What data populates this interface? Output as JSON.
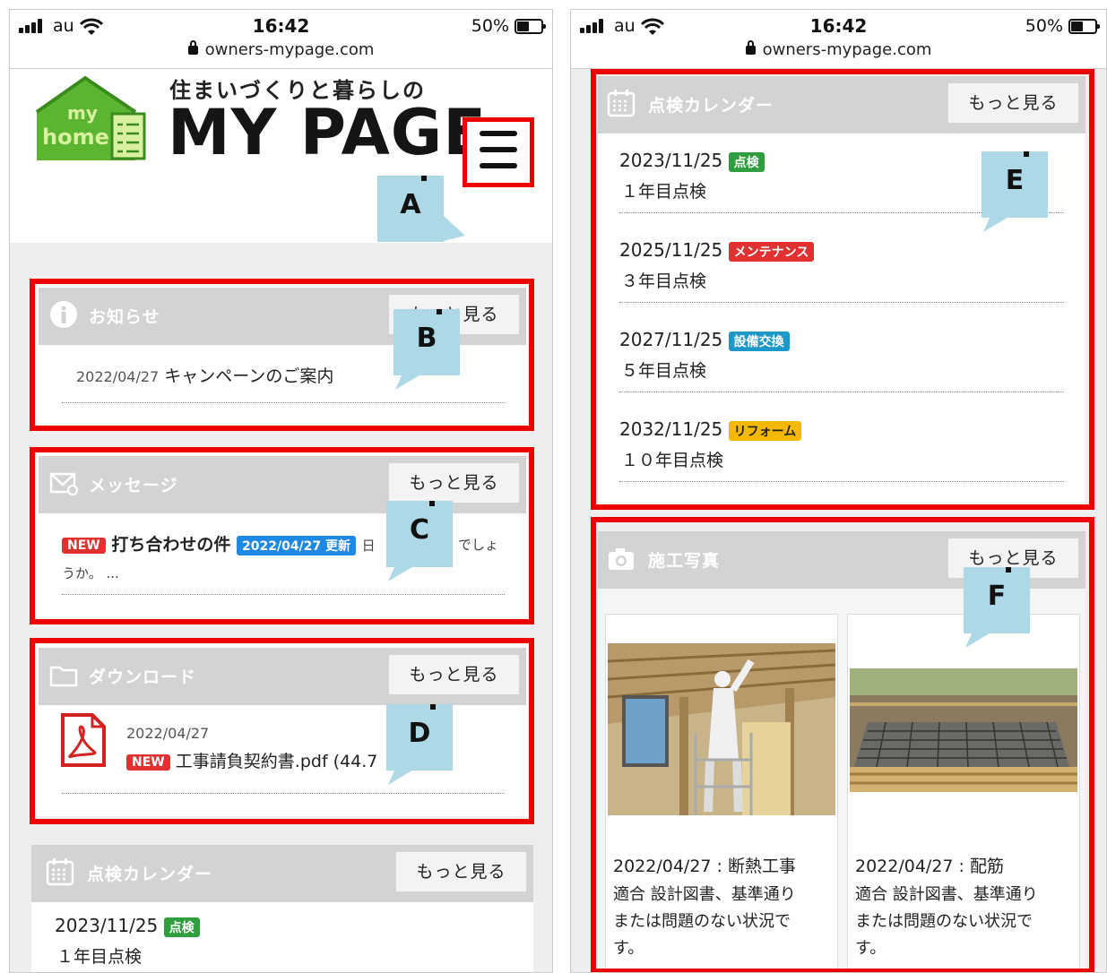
{
  "status_bar": {
    "carrier": "au",
    "time": "16:42",
    "battery": "50%",
    "url": "owners-mypage.com"
  },
  "header": {
    "tagline": "住まいづくりと暮らしの",
    "title": "MY PAGE",
    "logo_text_1": "my",
    "logo_text_2": "home"
  },
  "more_label": "もっと見る",
  "notices": {
    "title": "お知らせ",
    "date": "2022/04/27",
    "text": "キャンペーンのご案内"
  },
  "messages": {
    "title": "メッセージ",
    "new_badge": "NEW",
    "subject": "打ち合わせの件",
    "update_badge": "2022/04/27 更新",
    "preview_head": "日",
    "preview_tail": "でしょ",
    "preview_line2": "うか。 ..."
  },
  "downloads": {
    "title": "ダウンロード",
    "date": "2022/04/27",
    "new_badge": "NEW",
    "file": "工事請負契約書.pdf (44.7"
  },
  "calendar": {
    "title": "点検カレンダー",
    "items": [
      {
        "date": "2023/11/25",
        "badge": "点検",
        "badge_color": "#2e9e3e",
        "label": "１年目点検"
      },
      {
        "date": "2025/11/25",
        "badge": "メンテナンス",
        "badge_color": "#e03030",
        "label": "３年目点検"
      },
      {
        "date": "2027/11/25",
        "badge": "設備交換",
        "badge_color": "#1e98c8",
        "label": "５年目点検"
      },
      {
        "date": "2032/11/25",
        "badge": "リフォーム",
        "badge_color": "#f5b800",
        "label": "１０年目点検"
      }
    ]
  },
  "photos": {
    "title": "施工写真",
    "items": [
      {
        "caption": "2022/04/27 : 断熱工事",
        "line2": "適合 設計図書、基準通り",
        "line3": "または問題のない状況で",
        "line4": "す。"
      },
      {
        "caption": "2022/04/27 : 配筋",
        "line2": "適合 設計図書、基準通り",
        "line3": "または問題のない状況で",
        "line4": "す。"
      }
    ]
  },
  "callouts": {
    "a": "A",
    "b": "B",
    "c": "C",
    "d": "D",
    "e": "E",
    "f": "F"
  },
  "colors": {
    "red_box": "#ee0000",
    "callout_bg": "#add8e6",
    "new_badge": "#e03030",
    "update_badge": "#1e88e5"
  }
}
